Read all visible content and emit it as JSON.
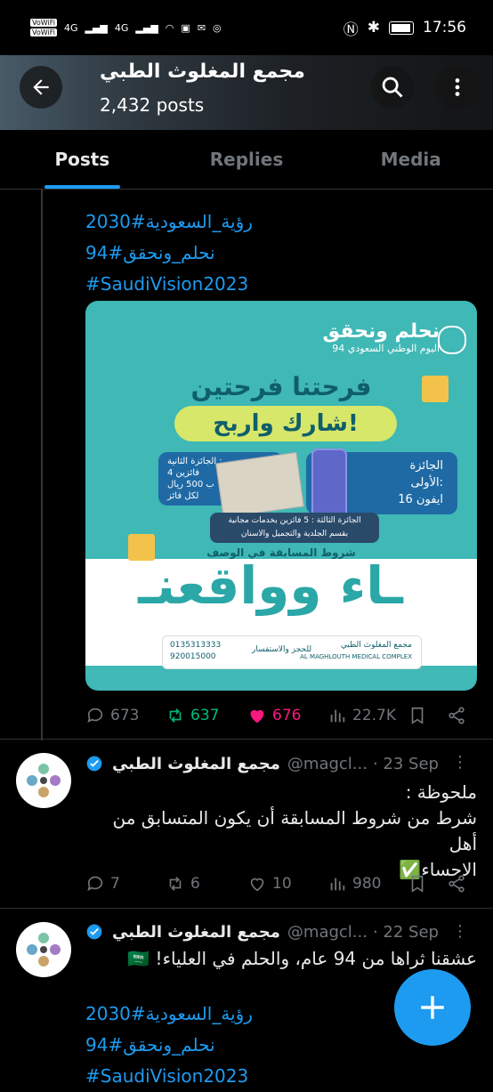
{
  "status_bar": {
    "wifi_badges": [
      "VoWiFi",
      "VoWiFi"
    ],
    "signal_labels": [
      "4G",
      "4G"
    ],
    "time": "17:56"
  },
  "header": {
    "title": "مجمع المغلوث الطبي",
    "post_count": "2,432 posts",
    "back_icon": "arrow-left-icon",
    "search_icon": "search-icon",
    "more_icon": "more-vertical-icon"
  },
  "tabs": [
    "Posts",
    "Replies",
    "Media"
  ],
  "post1": {
    "hashtags": [
      "رؤية_السعودية#2030",
      "نحلم_ونحقق#94",
      "#SaudiVision2023"
    ],
    "image": {
      "logo_title": "نحلم ونحقق",
      "logo_sub": "اليوم الوطني السعودي 94",
      "headline": "فرحتنا فرحتين",
      "pill": "شارك واربح!",
      "prize1": [
        "الجائزة",
        "الأولى:",
        "ايفون 16"
      ],
      "prize2": [
        "الجائزة الثانية :",
        "4 فائزين",
        "ب 500 ريال",
        "لكل فائز"
      ],
      "prize3": [
        "الجائزة الثالثة : 5 فائزين بخدمات مجانية",
        "بقسم الجلدية والتجميل والاسنان"
      ],
      "conditions": "شروط المسابقة في الوصف",
      "big_text": "ـاء وواقعنـ",
      "footer_name": "مجمع المغلوث الطبي",
      "footer_en": "AL MAGHLOUTH MEDICAL COMPLEX",
      "footer_phones": [
        "0135313333",
        "920015000"
      ],
      "footer_booking": "للحجز والاستفسار"
    },
    "stats": {
      "replies": "673",
      "reposts": "637",
      "likes": "676",
      "views": "22.7K"
    }
  },
  "post2": {
    "name": "مجمع المغلوث الطبي",
    "handle": "@magcl...",
    "date": "· 23 Sep",
    "lines": [
      "ملحوظة :",
      "شرط من شروط المسابقة أن يكون المتسابق من أهل",
      "الاحساء✅"
    ],
    "stats": {
      "replies": "7",
      "reposts": "6",
      "likes": "10",
      "views": "980"
    }
  },
  "post3": {
    "name": "مجمع المغلوث الطبي",
    "handle": "@magcl...",
    "date": "· 22 Sep",
    "lines": [
      "عشقنا ثراها من 94 عام، والحلم في العلياء! 🇸🇦"
    ],
    "hashtags": [
      "رؤية_السعودية#2030",
      "نحلم_ونحقق#94",
      "#SaudiVision2023"
    ]
  },
  "colors": {
    "accent": "#1d9bf0",
    "repost": "#00ba7c",
    "like": "#f91880",
    "muted": "#71767b"
  },
  "fab_icon": "plus-icon"
}
